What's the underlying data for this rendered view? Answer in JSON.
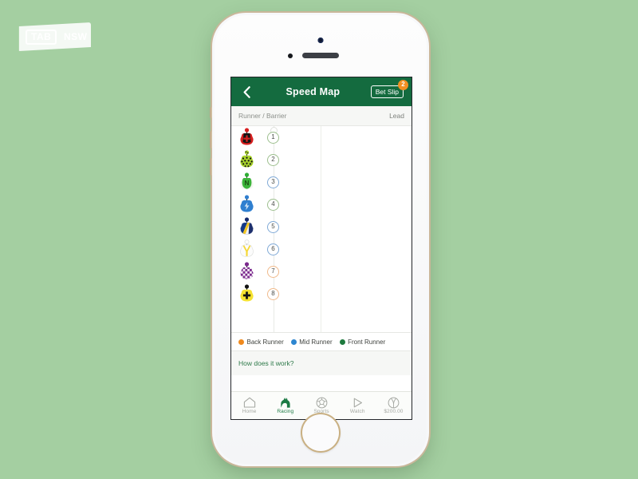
{
  "brand": {
    "logo_tab": "TAB",
    "logo_nsw": "NSW"
  },
  "navbar": {
    "back_icon": "chevron-left-icon",
    "title": "Speed Map",
    "betslip_label": "Bet Slip",
    "betslip_count": "2"
  },
  "column_header": {
    "left_label": "Runner / Barrier",
    "right_label": "Lead"
  },
  "runners": [
    {
      "barrier": "1",
      "ring": "#9dbf8e",
      "silk": "red-black-cap-red"
    },
    {
      "barrier": "2",
      "ring": "#9dbf8e",
      "silk": "lime-black-spots"
    },
    {
      "barrier": "3",
      "ring": "#7fa9d6",
      "silk": "green-white-letter-n"
    },
    {
      "barrier": "4",
      "ring": "#9dbf8e",
      "silk": "blue-lightning"
    },
    {
      "barrier": "5",
      "ring": "#7fa9d6",
      "silk": "navy-yellow-sash"
    },
    {
      "barrier": "6",
      "ring": "#7fa9d6",
      "silk": "white-yellow-braces"
    },
    {
      "barrier": "7",
      "ring": "#f0b98a",
      "silk": "purple-white-check"
    },
    {
      "barrier": "8",
      "ring": "#f0b98a",
      "silk": "yellow-black-cross"
    }
  ],
  "legend": [
    {
      "label": "Back Runner",
      "color": "#f08a1e"
    },
    {
      "label": "Mid Runner",
      "color": "#2d86d0"
    },
    {
      "label": "Front Runner",
      "color": "#1e7a3e"
    }
  ],
  "how_it_works": "How does it work?",
  "tabbar": [
    {
      "label": "Home",
      "icon": "home-icon",
      "active": false
    },
    {
      "label": "Racing",
      "icon": "horse-head-icon",
      "active": true
    },
    {
      "label": "Sports",
      "icon": "soccer-ball-icon",
      "active": false
    },
    {
      "label": "Watch",
      "icon": "play-triangle-icon",
      "active": false
    },
    {
      "label": "$200.00",
      "icon": "account-balance-icon",
      "active": false
    }
  ],
  "colors": {
    "background": "#a4cfa1",
    "brand_green": "#146b3f",
    "accent_orange": "#f29023"
  }
}
